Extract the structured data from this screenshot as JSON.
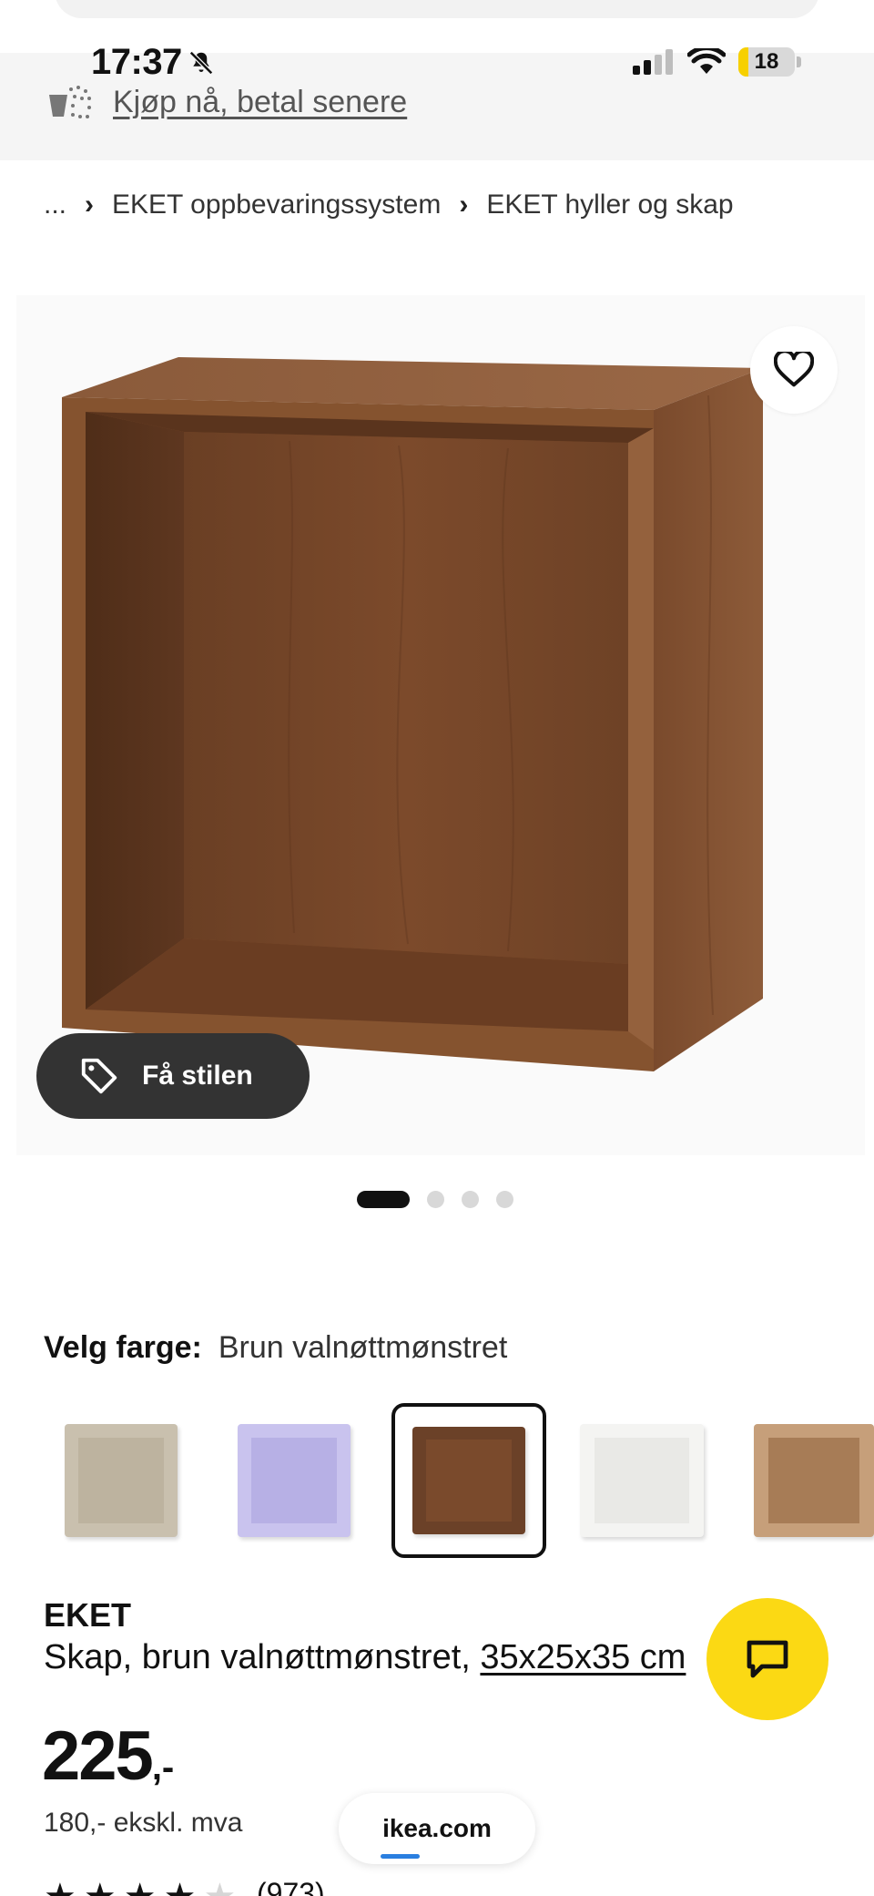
{
  "status_bar": {
    "time": "17:37",
    "battery_level": "18",
    "battery_fraction": 0.18,
    "icons": [
      "bell-slash-icon",
      "cellular-signal-icon",
      "wifi-icon",
      "battery-icon"
    ]
  },
  "promo_bar": {
    "text": "Kjøp nå, betal senere",
    "icon": "pay-later-basket-icon"
  },
  "breadcrumb": {
    "items": [
      "...",
      "EKET oppbevaringssystem",
      "EKET hyller og skap"
    ],
    "separator": "›"
  },
  "gallery": {
    "style_button_label": "Få stilen",
    "image_count": 4,
    "active_index": 0,
    "colors": {
      "wood_main": "#7a4a2c",
      "wood_dark": "#5a3520",
      "wood_light": "#8e5a38"
    }
  },
  "color_selector": {
    "label": "Velg farge:",
    "selected": "Brun valnøttmønstret",
    "swatches": [
      {
        "name": "beige",
        "color": "#c9c0ae",
        "inner": "#bdb39f"
      },
      {
        "name": "lilac",
        "color": "#c9c3ee",
        "inner": "#b7b0e5"
      },
      {
        "name": "brown-walnut",
        "color": "#6b4128",
        "inner": "#7a4a2c",
        "selected": true
      },
      {
        "name": "white",
        "color": "#f4f4f2",
        "inner": "#e9e9e6"
      },
      {
        "name": "oak",
        "color": "#c69f7a",
        "inner": "#a77c56"
      }
    ]
  },
  "product": {
    "name": "EKET",
    "description_prefix": "Skap, brun valnøttmønstret, ",
    "size_link": "35x25x35 cm",
    "price": "225",
    "price_suffix": ",-",
    "price_ex_vat": "180,- ekskl. mva",
    "rating": 4,
    "review_count": "(973)"
  },
  "browser": {
    "url": "ikea.com",
    "load_progress": 0.2
  },
  "accent_colors": {
    "ikea_yellow": "#fbd914",
    "dark_button": "#333333",
    "link_blue": "#2a7fe0"
  }
}
